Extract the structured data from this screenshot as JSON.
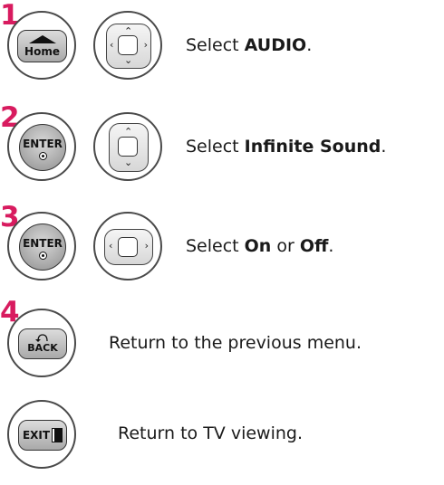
{
  "steps": [
    {
      "number": "1",
      "button_label": "Home",
      "text_prefix": "Select ",
      "text_bold": "AUDIO",
      "text_suffix": "."
    },
    {
      "number": "2",
      "button_label": "ENTER",
      "text_prefix": "Select ",
      "text_bold": "Infinite Sound",
      "text_suffix": "."
    },
    {
      "number": "3",
      "button_label": "ENTER",
      "text_prefix": "Select ",
      "text_bold": "On",
      "text_middle": " or ",
      "text_bold2": "Off",
      "text_suffix": "."
    },
    {
      "number": "4",
      "button_label": "BACK",
      "text": "Return to the previous menu."
    }
  ],
  "exit": {
    "button_label": "EXIT",
    "text": "Return to TV viewing."
  },
  "colors": {
    "step_number": "#d81b5f"
  },
  "icons": {
    "home": "home-roof-icon",
    "nav_full": "four-way-arrows-icon",
    "nav_vertical": "up-down-arrows-icon",
    "nav_horizontal": "left-right-arrows-icon",
    "back": "back-curved-arrow-icon",
    "exit": "door-icon"
  }
}
